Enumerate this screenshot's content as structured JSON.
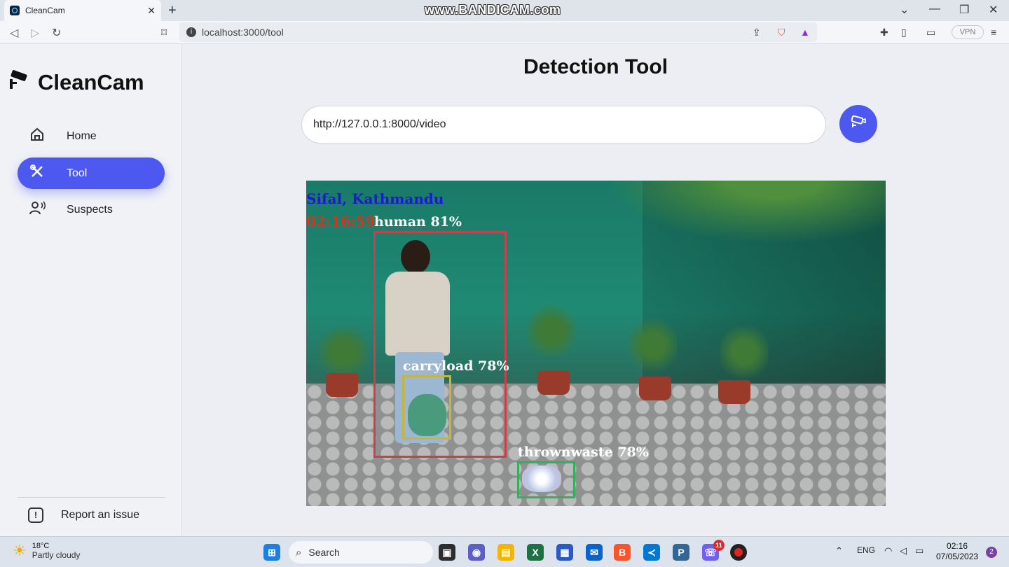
{
  "browser": {
    "tab_title": "CleanCam",
    "url": "localhost:3000/tool",
    "watermark": "www.BANDICAM.com",
    "vpn_label": "VPN"
  },
  "sidebar": {
    "brand": "CleanCam",
    "items": [
      {
        "label": "Home",
        "icon": "home-icon"
      },
      {
        "label": "Tool",
        "icon": "tool-icon",
        "active": true
      },
      {
        "label": "Suspects",
        "icon": "suspects-icon"
      }
    ],
    "report_label": "Report an issue"
  },
  "main": {
    "title": "Detection Tool",
    "stream_url": "http://127.0.0.1:8000/video",
    "submit_icon": "camera-send-icon",
    "feed": {
      "location": "Sifal, Kathmandu",
      "timestamp": "02:16:59",
      "detections": [
        {
          "label": "human 81%",
          "color": "#c8404a"
        },
        {
          "label": "carryload 78%",
          "color": "#c8b43c"
        },
        {
          "label": "thrownwaste 78%",
          "color": "#2fb35a"
        }
      ]
    }
  },
  "taskbar": {
    "weather_temp": "18°C",
    "weather_desc": "Partly cloudy",
    "search_label": "Search",
    "lang": "ENG",
    "time": "02:16",
    "date": "07/05/2023",
    "notif_count": "2",
    "viber_badge": "11"
  },
  "colors": {
    "accent": "#4d58f0",
    "location_text": "#1a1ad6",
    "timestamp_text": "#d2361f"
  }
}
